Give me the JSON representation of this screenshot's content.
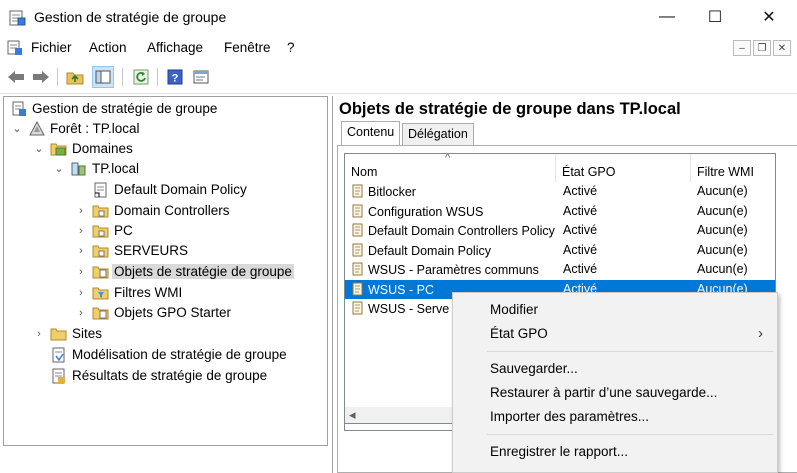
{
  "window": {
    "title": "Gestion de stratégie de groupe",
    "min": "—",
    "max": "☐",
    "close": "✕"
  },
  "menu": [
    "Fichier",
    "Action",
    "Affichage",
    "Fenêtre",
    "?"
  ],
  "mdi": {
    "min": "–",
    "restore": "❐",
    "close": "✕"
  },
  "tree": [
    {
      "label": "Gestion de stratégie de groupe",
      "icon": "gpm-root-icon",
      "expander": ""
    },
    {
      "label": "Forêt : TP.local",
      "icon": "forest-icon",
      "expander": "expanded"
    },
    {
      "label": "Domaines",
      "icon": "domains-folder-icon",
      "expander": "expanded"
    },
    {
      "label": "TP.local",
      "icon": "domain-icon",
      "expander": "expanded"
    },
    {
      "label": "Default Domain Policy",
      "icon": "gpo-link-icon",
      "expander": ""
    },
    {
      "label": "Domain Controllers",
      "icon": "ou-folder-icon",
      "expander": "collapsed"
    },
    {
      "label": "PC",
      "icon": "ou-folder-icon",
      "expander": "collapsed"
    },
    {
      "label": "SERVEURS",
      "icon": "ou-folder-icon",
      "expander": "collapsed"
    },
    {
      "label": "Objets de stratégie de groupe",
      "icon": "gpo-folder-icon",
      "expander": "collapsed",
      "selected": true
    },
    {
      "label": "Filtres WMI",
      "icon": "wmi-folder-icon",
      "expander": "collapsed"
    },
    {
      "label": "Objets GPO Starter",
      "icon": "starter-folder-icon",
      "expander": "collapsed"
    },
    {
      "label": "Sites",
      "icon": "sites-icon",
      "expander": "collapsed"
    },
    {
      "label": "Modélisation de stratégie de groupe",
      "icon": "modeling-icon",
      "expander": ""
    },
    {
      "label": "Résultats de stratégie de groupe",
      "icon": "results-icon",
      "expander": ""
    }
  ],
  "right": {
    "title": "Objets de stratégie de groupe dans TP.local",
    "tabs": [
      "Contenu",
      "Délégation"
    ],
    "columns": [
      "Nom",
      "État GPO",
      "Filtre WMI"
    ],
    "sort_indicator": "^",
    "rows": [
      {
        "name": "Bitlocker",
        "state": "Activé",
        "wmi": "Aucun(e)"
      },
      {
        "name": "Configuration WSUS",
        "state": "Activé",
        "wmi": "Aucun(e)"
      },
      {
        "name": "Default Domain Controllers Policy",
        "state": "Activé",
        "wmi": "Aucun(e)"
      },
      {
        "name": "Default Domain Policy",
        "state": "Activé",
        "wmi": "Aucun(e)"
      },
      {
        "name": "WSUS - Paramètres communs",
        "state": "Activé",
        "wmi": "Aucun(e)"
      },
      {
        "name": "WSUS - PC",
        "state": "Activé",
        "wmi": "Aucun(e)",
        "selected": true
      },
      {
        "name": "WSUS - Serve",
        "state": "",
        "wmi": ""
      }
    ],
    "scroll_left": "◂"
  },
  "context_menu": {
    "items": [
      {
        "label": "Modifier",
        "submenu": false
      },
      {
        "label": "État GPO",
        "submenu": true
      },
      {
        "sep": true
      },
      {
        "label": "Sauvegarder...",
        "submenu": false
      },
      {
        "label": "Restaurer à partir d’une sauvegarde...",
        "submenu": false
      },
      {
        "label": "Importer des paramètres...",
        "submenu": false
      },
      {
        "sep": true
      },
      {
        "label": "Enregistrer le rapport...",
        "submenu": false
      }
    ],
    "submenu_arrow": "›"
  },
  "colors": {
    "selection": "#0078d7",
    "tree_selection": "#d9d9d9",
    "menu_bg": "#f2f2f2"
  }
}
